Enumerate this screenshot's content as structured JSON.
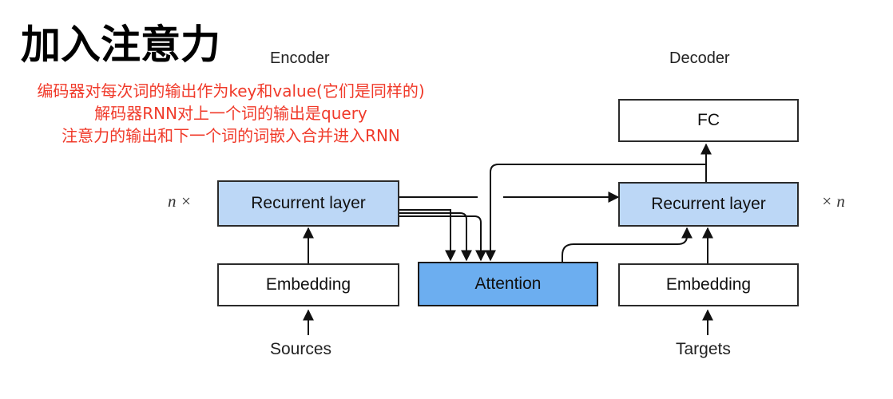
{
  "title": "加入注意力",
  "notes": [
    "编码器对每次词的输出作为key和value(它们是同样的)",
    "解码器RNN对上一个词的输出是query",
    "注意力的输出和下一个词的词嵌入合并进入RNN"
  ],
  "encoder": {
    "heading": "Encoder",
    "recurrent_label": "Recurrent layer",
    "embedding_label": "Embedding",
    "input_label": "Sources",
    "multiplier": "n ×"
  },
  "attention": {
    "label": "Attention"
  },
  "decoder": {
    "heading": "Decoder",
    "fc_label": "FC",
    "recurrent_label": "Recurrent layer",
    "embedding_label": "Embedding",
    "input_label": "Targets",
    "multiplier": "× n"
  },
  "colors": {
    "note_text": "#f03a2a",
    "recurrent_fill": "#bcd7f6",
    "attention_fill": "#6caef0",
    "stroke": "#2b2b2b"
  }
}
